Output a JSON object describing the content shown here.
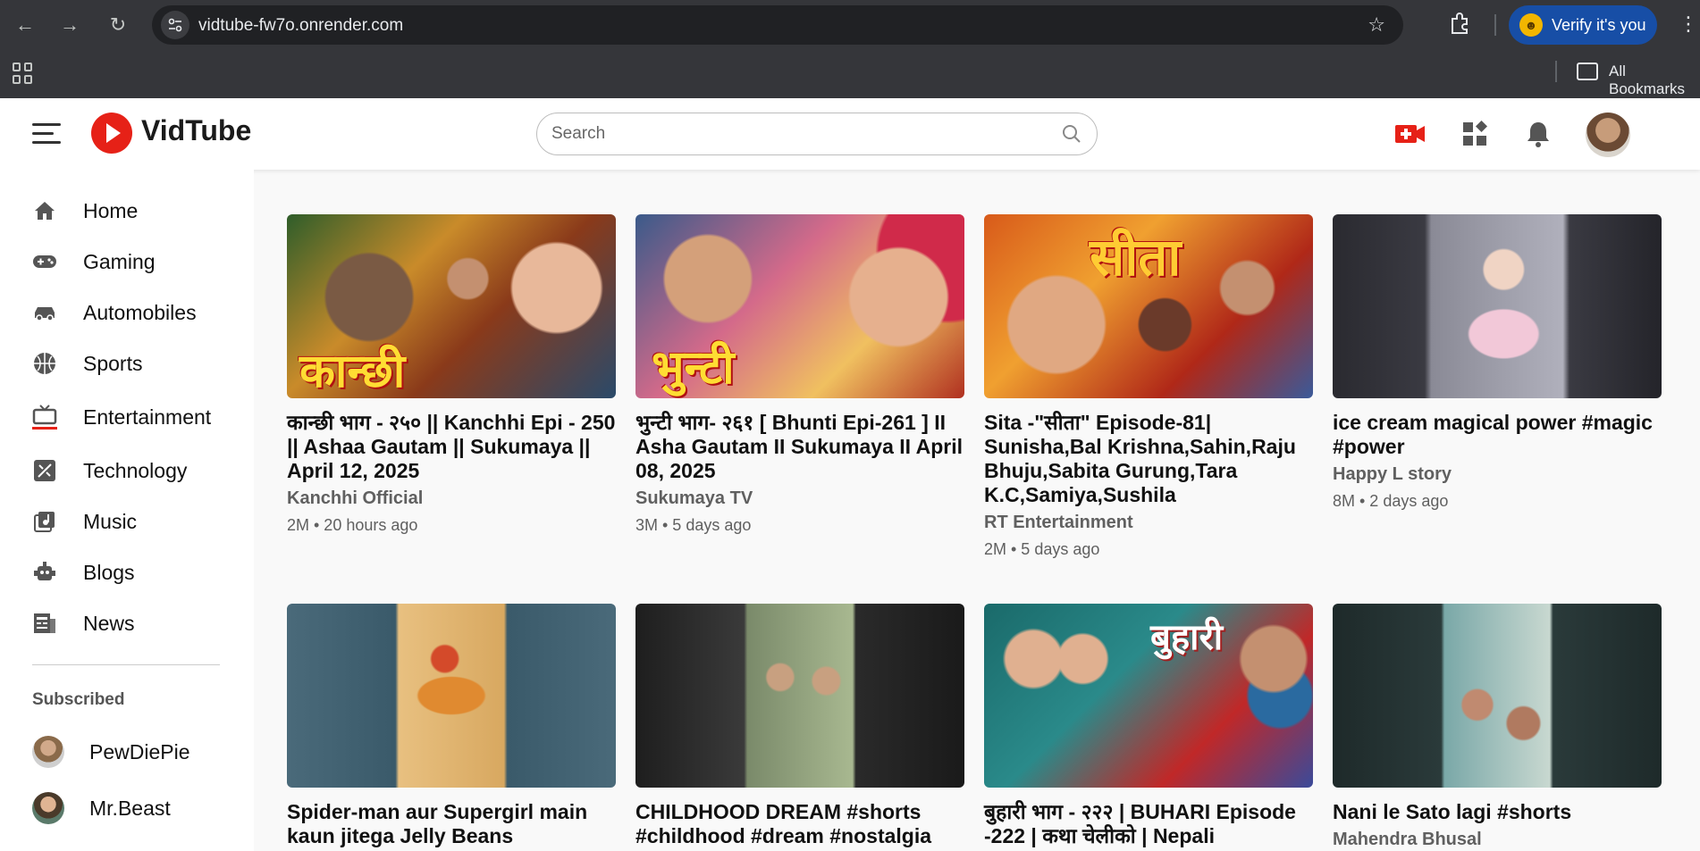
{
  "browser": {
    "url": "vidtube-fw7o.onrender.com",
    "profile_label": "Verify it's you",
    "bookmarks_label": "All Bookmarks"
  },
  "header": {
    "app_name": "VidTube",
    "search_placeholder": "Search",
    "accent_color": "#e62117"
  },
  "sidebar": {
    "items": [
      {
        "label": "Home",
        "icon": "home-icon"
      },
      {
        "label": "Gaming",
        "icon": "gamepad-icon"
      },
      {
        "label": "Automobiles",
        "icon": "car-icon"
      },
      {
        "label": "Sports",
        "icon": "basketball-icon"
      },
      {
        "label": "Entertainment",
        "icon": "tv-icon"
      },
      {
        "label": "Technology",
        "icon": "tech-icon"
      },
      {
        "label": "Music",
        "icon": "music-icon"
      },
      {
        "label": "Blogs",
        "icon": "blog-icon"
      },
      {
        "label": "News",
        "icon": "news-icon"
      }
    ],
    "subscribed_title": "Subscribed",
    "subscriptions": [
      {
        "name": "PewDiePie"
      },
      {
        "name": "Mr.Beast"
      }
    ]
  },
  "videos": [
    {
      "title": "कान्छी भाग - २५० || Kanchhi Epi - 250 || Ashaa Gautam || Sukumaya || April 12, 2025",
      "channel": "Kanchhi Official",
      "meta": "2M • 20 hours ago",
      "thumb_text": "कान्छी"
    },
    {
      "title": "भुन्टी भाग- २६१ [ Bhunti Epi-261 ] II Asha Gautam II Sukumaya II April 08, 2025",
      "channel": "Sukumaya TV",
      "meta": "3M • 5 days ago",
      "thumb_text": "भुन्टी"
    },
    {
      "title": "Sita -\"सीता\" Episode-81| Sunisha,Bal Krishna,Sahin,Raju Bhuju,Sabita Gurung,Tara K.C,Samiya,Sushila",
      "channel": "RT Entertainment",
      "meta": "2M • 5 days ago",
      "thumb_text": "सीता"
    },
    {
      "title": "ice cream magical power #magic #power",
      "channel": "Happy L story",
      "meta": "8M • 2 days ago",
      "thumb_text": ""
    },
    {
      "title": "Spider-man aur Supergirl main kaun jitega Jelly Beans",
      "channel": "",
      "meta": "",
      "thumb_text": ""
    },
    {
      "title": "CHILDHOOD DREAM #shorts #childhood #dream #nostalgia",
      "channel": "",
      "meta": "",
      "thumb_text": ""
    },
    {
      "title": "बुहारी भाग - २२२ | BUHARI Episode -222 | कथा चेलीको | Nepali",
      "channel": "",
      "meta": "",
      "thumb_text": "बुहारी"
    },
    {
      "title": "Nani le Sato lagi #shorts",
      "channel": "Mahendra Bhusal",
      "meta": "",
      "thumb_text": ""
    }
  ]
}
